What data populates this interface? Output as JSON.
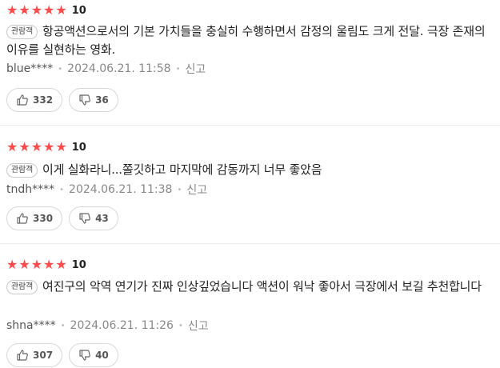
{
  "reviews": [
    {
      "stars": 5,
      "score": "10",
      "badge": "관람객",
      "text": "항공액션으로서의 기본 가치들을 충실히 수행하면서 감정의 울림도 크게 전달. 극장 존재의 이유를 실현하는 영화.",
      "user": "blue****",
      "date": "2024.06.21. 11:58",
      "report": "신고",
      "likes": "332",
      "dislikes": "36"
    },
    {
      "stars": 5,
      "score": "10",
      "badge": "관람객",
      "text": "이게 실화라니...쫄깃하고 마지막에 감동까지 너무 좋았음",
      "user": "tndh****",
      "date": "2024.06.21. 11:38",
      "report": "신고",
      "likes": "330",
      "dislikes": "43"
    },
    {
      "stars": 5,
      "score": "10",
      "badge": "관람객",
      "text": "여진구의 악역 연기가 진짜 인상깊었습니다 액션이 워낙 좋아서 극장에서 보길 추천합니다",
      "user": "shna****",
      "date": "2024.06.21. 11:26",
      "report": "신고",
      "likes": "307",
      "dislikes": "40"
    }
  ],
  "colors": {
    "star": "#ff4b4b",
    "muted": "#888888"
  },
  "icons": {
    "like": "thumbs-up-icon",
    "dislike": "thumbs-down-icon",
    "star": "star-icon"
  }
}
